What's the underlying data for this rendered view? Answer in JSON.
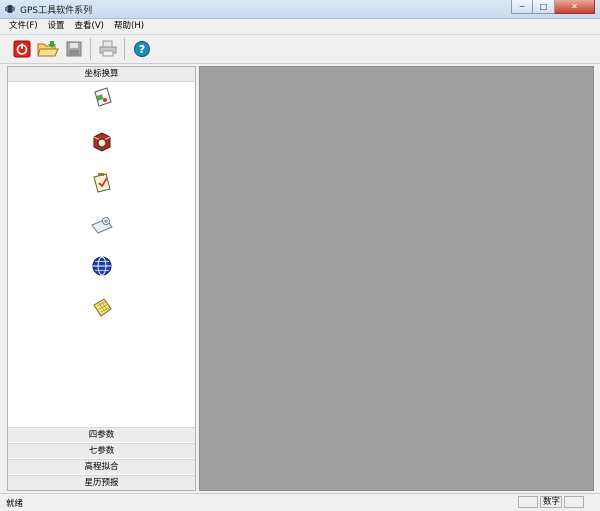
{
  "window": {
    "title": "GPS工具软件系列",
    "minimize": "─",
    "maximize": "□",
    "close": "✕"
  },
  "menu": [
    "文件(F)",
    "设置",
    "查看(V)",
    "帮助(H)"
  ],
  "toolbar": {
    "buttons": [
      {
        "icon": "power-icon",
        "enabled": true
      },
      {
        "icon": "open-folder-icon",
        "enabled": true
      },
      {
        "icon": "save-icon",
        "enabled": false
      },
      {
        "icon": "print-icon",
        "enabled": false
      },
      {
        "icon": "help-icon",
        "enabled": true
      }
    ]
  },
  "left_panel": {
    "active_section": "坐标换算",
    "tools": [
      {
        "icon": "document-chart-icon"
      },
      {
        "icon": "gear-cube-icon"
      },
      {
        "icon": "checklist-clipboard-icon"
      },
      {
        "icon": "map-folder-icon"
      },
      {
        "icon": "globe-icon"
      },
      {
        "icon": "grid-note-icon"
      }
    ],
    "sections": [
      "四参数",
      "七参数",
      "高程拟合",
      "星历预报"
    ]
  },
  "status": {
    "text": "就绪",
    "numlock": "数字"
  },
  "colors": {
    "mdi_background": "#9f9f9f",
    "panel_header": "#ececec"
  }
}
